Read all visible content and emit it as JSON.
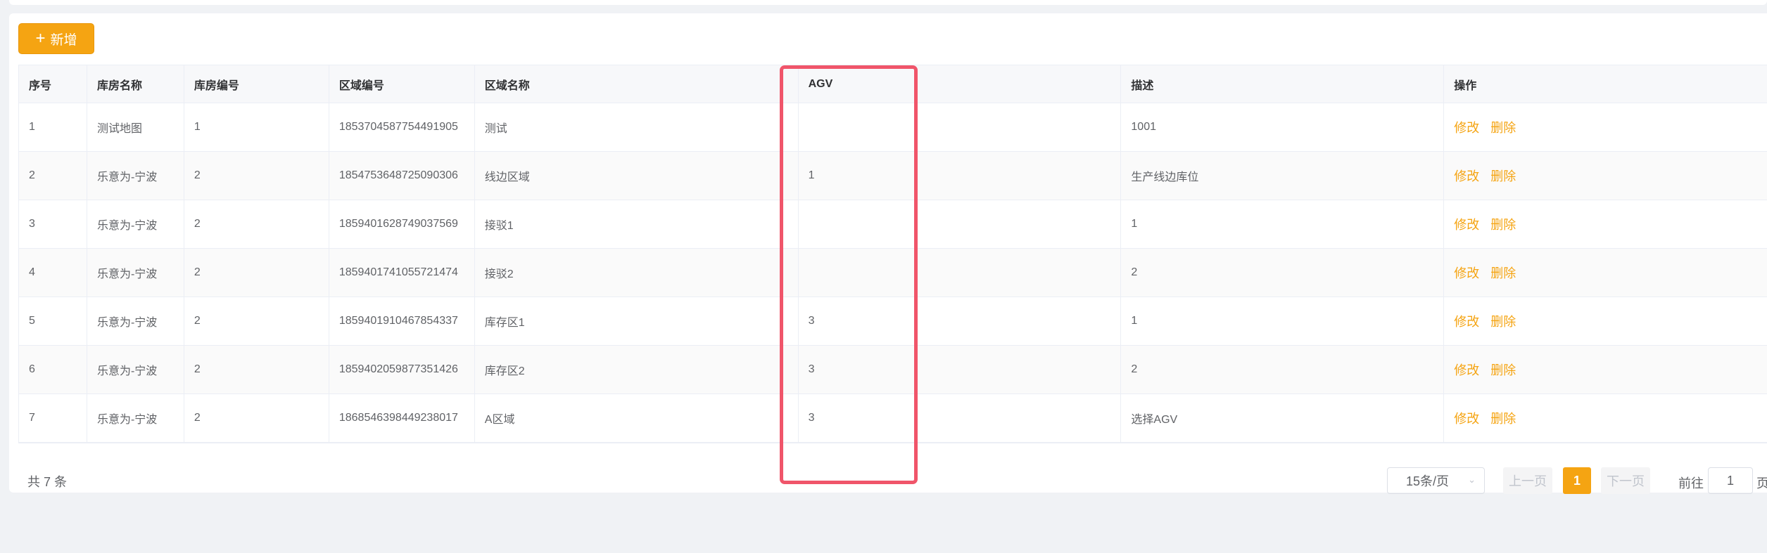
{
  "toolbar": {
    "add_label": "新增"
  },
  "table": {
    "columns": [
      "序号",
      "库房名称",
      "库房编号",
      "区域编号",
      "区域名称",
      "AGV",
      "描述",
      "操作"
    ],
    "rows": [
      {
        "index": "1",
        "warehouse_name": "测试地图",
        "warehouse_code": "1",
        "area_code": "1853704587754491905",
        "area_name": "测试",
        "agv": "",
        "desc": "1001"
      },
      {
        "index": "2",
        "warehouse_name": "乐意为-宁波",
        "warehouse_code": "2",
        "area_code": "1854753648725090306",
        "area_name": "线边区域",
        "agv": "1",
        "desc": "生产线边库位"
      },
      {
        "index": "3",
        "warehouse_name": "乐意为-宁波",
        "warehouse_code": "2",
        "area_code": "1859401628749037569",
        "area_name": "接驳1",
        "agv": "",
        "desc": "1"
      },
      {
        "index": "4",
        "warehouse_name": "乐意为-宁波",
        "warehouse_code": "2",
        "area_code": "1859401741055721474",
        "area_name": "接驳2",
        "agv": "",
        "desc": "2"
      },
      {
        "index": "5",
        "warehouse_name": "乐意为-宁波",
        "warehouse_code": "2",
        "area_code": "1859401910467854337",
        "area_name": "库存区1",
        "agv": "3",
        "desc": "1"
      },
      {
        "index": "6",
        "warehouse_name": "乐意为-宁波",
        "warehouse_code": "2",
        "area_code": "1859402059877351426",
        "area_name": "库存区2",
        "agv": "3",
        "desc": "2"
      },
      {
        "index": "7",
        "warehouse_name": "乐意为-宁波",
        "warehouse_code": "2",
        "area_code": "1868546398449238017",
        "area_name": "A区域",
        "agv": "3",
        "desc": "选择AGV"
      }
    ],
    "actions": {
      "edit": "修改",
      "delete": "删除"
    }
  },
  "pagination": {
    "total": "共 7 条",
    "page_size": "15条/页",
    "prev": "上一页",
    "current": "1",
    "next": "下一页",
    "goto_label": "前往",
    "goto_value": "1",
    "goto_suffix": "页"
  },
  "colors": {
    "accent": "#f5a412",
    "highlight": "#f0556a"
  }
}
